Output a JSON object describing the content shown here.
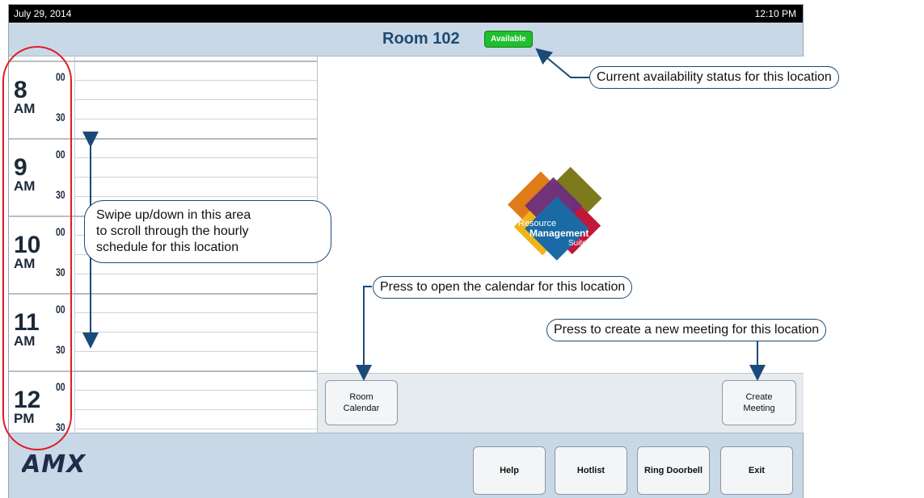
{
  "status_bar": {
    "date": "July 29, 2014",
    "time": "12:10 PM"
  },
  "header": {
    "room_name": "Room 102",
    "status": "Available"
  },
  "schedule": {
    "hours": [
      {
        "hour": "8",
        "ampm": "AM",
        "min_00": "00",
        "min_30": "30"
      },
      {
        "hour": "9",
        "ampm": "AM",
        "min_00": "00",
        "min_30": "30"
      },
      {
        "hour": "10",
        "ampm": "AM",
        "min_00": "00",
        "min_30": "30"
      },
      {
        "hour": "11",
        "ampm": "AM",
        "min_00": "00",
        "min_30": "30"
      },
      {
        "hour": "12",
        "ampm": "PM",
        "min_00": "00",
        "min_30": "30"
      }
    ]
  },
  "logo": {
    "line1": "Resource",
    "line2": "Management",
    "line3": "Suite"
  },
  "actions": {
    "room_calendar_line1": "Room",
    "room_calendar_line2": "Calendar",
    "create_meeting_line1": "Create",
    "create_meeting_line2": "Meeting"
  },
  "footer": {
    "brand": "AMX",
    "help": "Help",
    "hotlist": "Hotlist",
    "ring_doorbell": "Ring Doorbell",
    "exit": "Exit"
  },
  "callouts": {
    "availability": "Current availability status for this location",
    "swipe_line1": "Swipe up/down in this area",
    "swipe_line2": "to scroll through the hourly",
    "swipe_line3": "schedule for this location",
    "calendar": "Press to open the calendar for this location",
    "create": "Press to create a new meeting for this location"
  },
  "colors": {
    "header_bg": "#c8d8e6",
    "status_green": "#1fbf2d",
    "callout_border": "#1b4a78",
    "highlight_red": "#e01b24",
    "title_blue": "#1d4a72"
  }
}
